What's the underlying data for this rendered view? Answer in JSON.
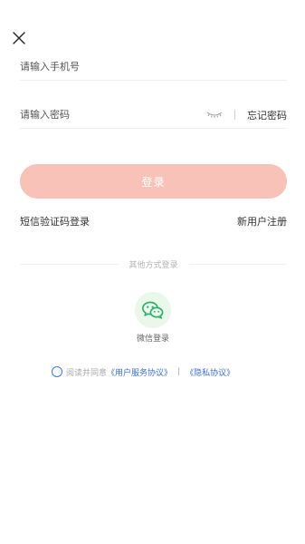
{
  "form": {
    "phone_placeholder": "请输入手机号",
    "password_placeholder": "请输入密码",
    "forgot_password": "忘记密码",
    "login_button": "登录",
    "sms_login": "短信验证码登录",
    "register": "新用户注册"
  },
  "other_login": {
    "title": "其他方式登录",
    "wechat_label": "微信登录"
  },
  "agreement": {
    "prefix": "阅读并同意",
    "user_agreement": "《用户服务协议》",
    "separator": "|",
    "privacy_agreement": "《隐私协议》"
  },
  "colors": {
    "login_button": "#f9c2b8",
    "wechat_green": "#2aae67",
    "link_blue": "#3d6fc9"
  }
}
